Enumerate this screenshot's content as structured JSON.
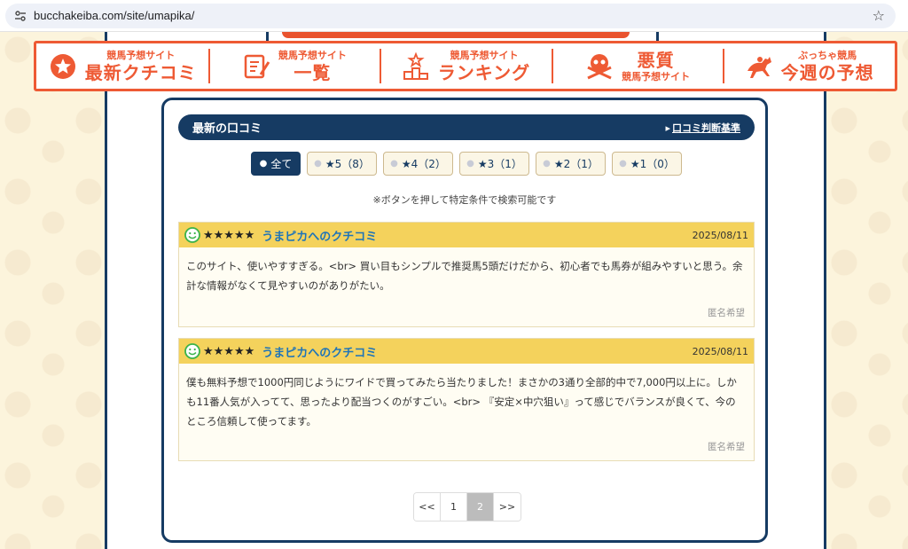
{
  "browser": {
    "url": "bucchakeiba.com/site/umapika/"
  },
  "colors": {
    "navy": "#163b63",
    "orange": "#ee5a34",
    "yellow": "#f4d25c",
    "link_blue": "#1e74b8"
  },
  "nav": [
    {
      "small": "競馬予想サイト",
      "big": "最新クチコミ",
      "icon": "star-badge-icon"
    },
    {
      "small": "競馬予想サイト",
      "big": "一覧",
      "icon": "checklist-icon"
    },
    {
      "small": "競馬予想サイト",
      "big": "ランキング",
      "icon": "podium-icon"
    },
    {
      "small": "競馬予想サイト",
      "big": "悪質",
      "icon": "skull-icon"
    },
    {
      "small": "ぶっちゃ競馬",
      "big": "今週の予想",
      "icon": "racehorse-icon"
    }
  ],
  "section": {
    "title": "最新の口コミ",
    "criteria_link": "口コミ判断基準"
  },
  "filters": [
    {
      "label": "全て",
      "active": true
    },
    {
      "label": "★5（8）",
      "active": false
    },
    {
      "label": "★4（2）",
      "active": false
    },
    {
      "label": "★3（1）",
      "active": false
    },
    {
      "label": "★2（1）",
      "active": false
    },
    {
      "label": "★1（0）",
      "active": false
    }
  ],
  "note": "※ボタンを押して特定条件で検索可能です",
  "reviews": [
    {
      "stars": "★★★★★",
      "title": "うまピカへのクチコミ",
      "date": "2025/08/11",
      "body": "このサイト、使いやすすぎる。<br> 買い目もシンプルで推奨馬5頭だけだから、初心者でも馬券が組みやすいと思う。余計な情報がなくて見やすいのがありがたい。",
      "author": "匿名希望"
    },
    {
      "stars": "★★★★★",
      "title": "うまピカへのクチコミ",
      "date": "2025/08/11",
      "body": "僕も無料予想で1000円同じようにワイドで買ってみたら当たりました！まさかの3通り全部的中で7,000円以上に。しかも11番人気が入ってて、思ったより配当つくのがすごい。<br> 『安定×中穴狙い』って感じでバランスが良くて、今のところ信頼して使ってます。",
      "author": "匿名希望"
    }
  ],
  "pagination": {
    "prev": "<<",
    "pages": [
      "1",
      "2"
    ],
    "current": "2",
    "next": ">>"
  }
}
